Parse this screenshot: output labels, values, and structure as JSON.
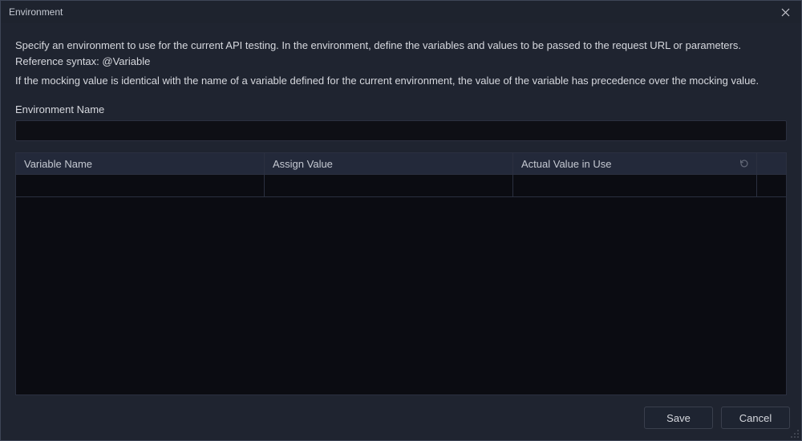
{
  "window": {
    "title": "Environment"
  },
  "description": {
    "line1": "Specify an environment to use for the current API testing. In the environment, define the variables and values to be passed to the request URL or parameters. Reference syntax: @Variable",
    "line2": "If the mocking value is identical with the name of a variable defined for the current environment, the value of the variable has precedence over the mocking value."
  },
  "form": {
    "name_label": "Environment Name",
    "name_value": ""
  },
  "table": {
    "columns": {
      "variable_name": "Variable Name",
      "assign_value": "Assign Value",
      "actual_value": "Actual Value in Use"
    },
    "rows": []
  },
  "buttons": {
    "save": "Save",
    "cancel": "Cancel"
  }
}
